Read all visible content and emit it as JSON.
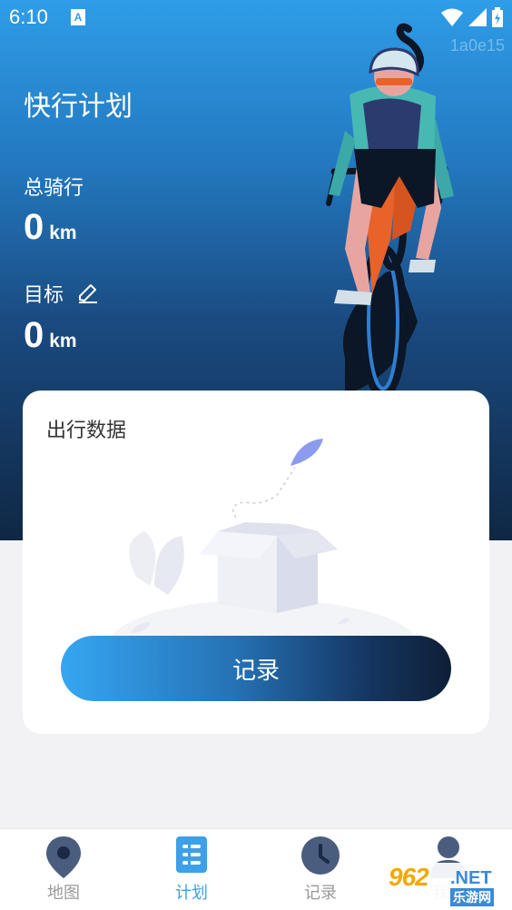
{
  "status_bar": {
    "time": "6:10",
    "notification_glyph": "A",
    "watermark": "1a0e15",
    "icons": [
      "wifi-icon",
      "cell-signal-icon",
      "battery-icon"
    ]
  },
  "header": {
    "title": "快行计划",
    "total_ride_label": "总骑行",
    "total_ride_value": "0",
    "total_ride_unit": "km",
    "goal_label": "目标",
    "goal_value": "0",
    "goal_unit": "km"
  },
  "card": {
    "title": "出行数据",
    "record_button": "记录"
  },
  "tabs": [
    {
      "label": "地图",
      "icon": "map-pin-icon",
      "active": false
    },
    {
      "label": "计划",
      "icon": "plan-list-icon",
      "active": true
    },
    {
      "label": "记录",
      "icon": "clock-icon",
      "active": false
    },
    {
      "label": "我的",
      "icon": "person-icon",
      "active": false
    }
  ],
  "overlay_logo": {
    "number": "962",
    "net": ".NET",
    "sub": "乐游网"
  },
  "colors": {
    "accent": "#3da0e8",
    "hero_top": "#2f9de8",
    "hero_bottom": "#0f2744",
    "tab_inactive": "#9a9a9a",
    "tab_icon_dark": "#4a5d7e"
  }
}
